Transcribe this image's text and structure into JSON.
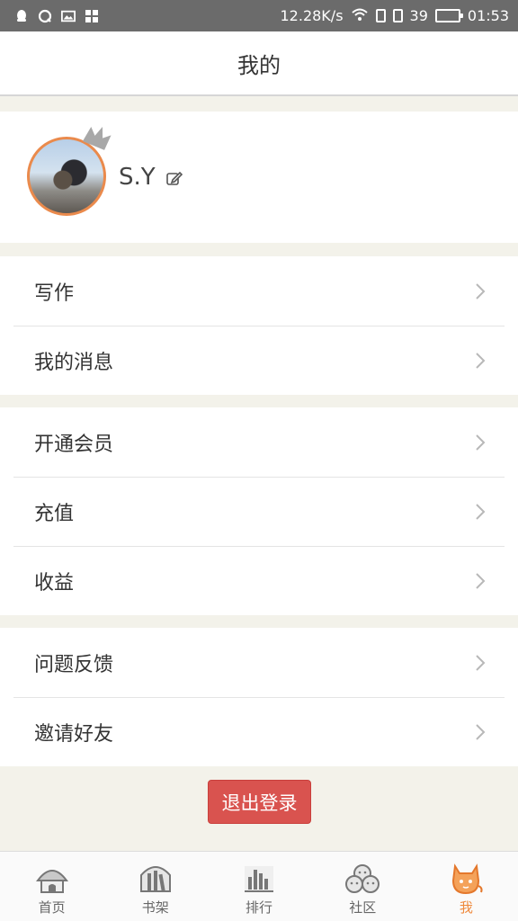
{
  "status_bar": {
    "net_speed": "12.28K/s",
    "battery": "39",
    "battery_level": 0.39,
    "time": "01:53"
  },
  "header": {
    "title": "我的"
  },
  "profile": {
    "username": "S.Y"
  },
  "menu_groups": [
    [
      {
        "label": "写作"
      },
      {
        "label": "我的消息"
      }
    ],
    [
      {
        "label": "开通会员"
      },
      {
        "label": "充值"
      },
      {
        "label": "收益"
      }
    ],
    [
      {
        "label": "问题反馈"
      },
      {
        "label": "邀请好友"
      }
    ]
  ],
  "logout_label": "退出登录",
  "tabs": [
    {
      "label": "首页",
      "icon": "home-icon"
    },
    {
      "label": "书架",
      "icon": "bookshelf-icon"
    },
    {
      "label": "排行",
      "icon": "ranking-icon"
    },
    {
      "label": "社区",
      "icon": "community-icon"
    },
    {
      "label": "我",
      "icon": "cat-icon",
      "active": true
    }
  ],
  "colors": {
    "accent": "#ef8a3d",
    "logout": "#d9534f",
    "page_bg": "#f3f2ea",
    "status_bar": "#6b6b6b"
  }
}
